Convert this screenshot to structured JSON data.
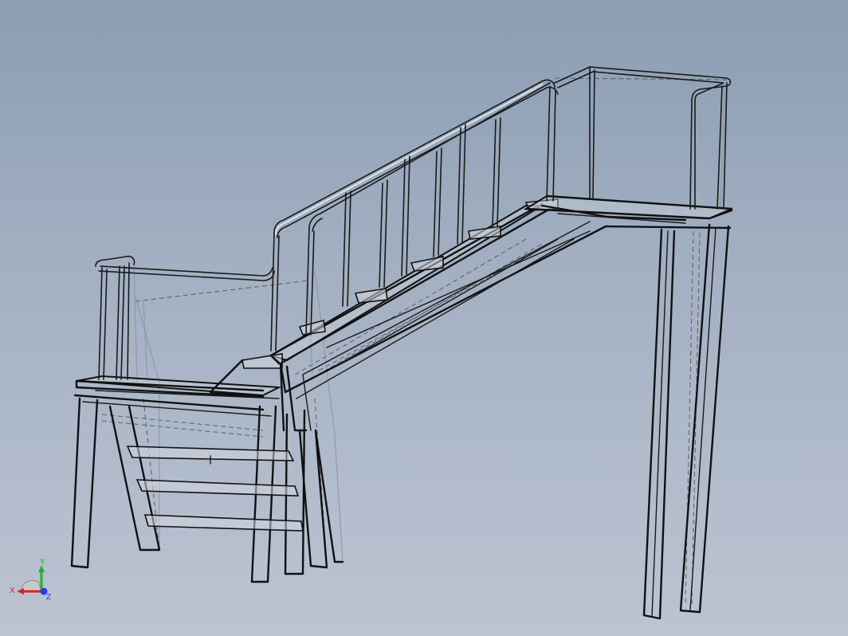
{
  "viewport": {
    "background_top": "#8b9db3",
    "background_bottom": "#bcc4d2",
    "edge_color": "#111111"
  },
  "triad": {
    "x_label": "X",
    "y_label": "Y",
    "z_label": "Z",
    "x_color": "#e02020",
    "y_color": "#20b030",
    "z_color": "#2040e0"
  }
}
